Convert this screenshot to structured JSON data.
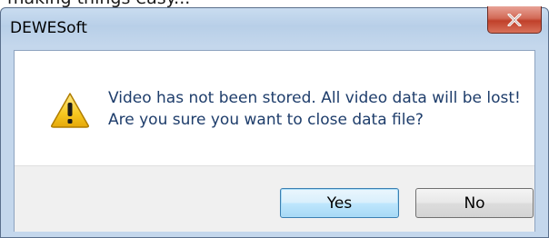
{
  "background_caption": "making things easy...",
  "dialog": {
    "title": "DEWESoft",
    "close_button_glyph": "x",
    "icon": "warning-icon",
    "message_line1": "Video has not been stored. All video data will be lost!",
    "message_line2": "Are you sure you want to close data file?",
    "buttons": {
      "yes_label": "Yes",
      "no_label": "No"
    }
  },
  "colors": {
    "titlebar": "#b8cfe8",
    "close_button": "#c0402a",
    "message_text": "#1e3d6b",
    "warning_yellow": "#f6c820",
    "default_button_border": "#3c7fb1"
  }
}
